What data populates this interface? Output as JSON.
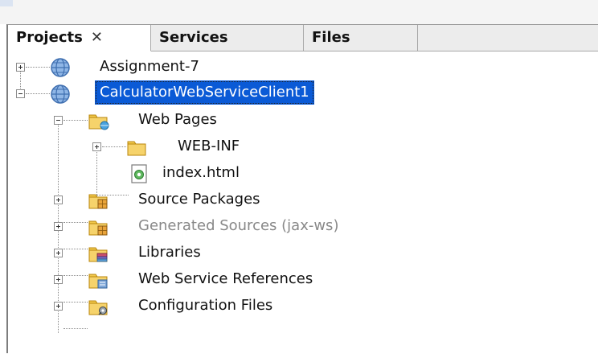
{
  "tabs": [
    {
      "label": "Projects",
      "active": true,
      "closable": true,
      "close_glyph": "✕"
    },
    {
      "label": "Services",
      "active": false
    },
    {
      "label": "Files",
      "active": false
    }
  ],
  "tree": {
    "nodes": [
      {
        "label": "Assignment-7",
        "icon": "globe-icon",
        "expander": "plus"
      },
      {
        "label": "CalculatorWebServiceClient1",
        "icon": "globe-icon",
        "expander": "minus",
        "selected": true
      },
      {
        "label": "Web Pages",
        "icon": "web-pages-folder-icon",
        "expander": "minus"
      },
      {
        "label": "WEB-INF",
        "icon": "folder-icon",
        "expander": "plus"
      },
      {
        "label": "index.html",
        "icon": "html-file-icon",
        "expander": "none"
      },
      {
        "label": "Source Packages",
        "icon": "package-folder-icon",
        "expander": "plus"
      },
      {
        "label": "Generated Sources (jax-ws)",
        "icon": "package-folder-icon",
        "expander": "plus",
        "muted": true
      },
      {
        "label": "Libraries",
        "icon": "libraries-folder-icon",
        "expander": "plus"
      },
      {
        "label": "Web Service References",
        "icon": "web-service-references-icon",
        "expander": "plus"
      },
      {
        "label": "Configuration Files",
        "icon": "configuration-files-icon",
        "expander": "plus"
      }
    ]
  },
  "colors": {
    "selection": "#0a5ad6",
    "folder": "#e8b53a",
    "globe": "#5b8fd1"
  }
}
